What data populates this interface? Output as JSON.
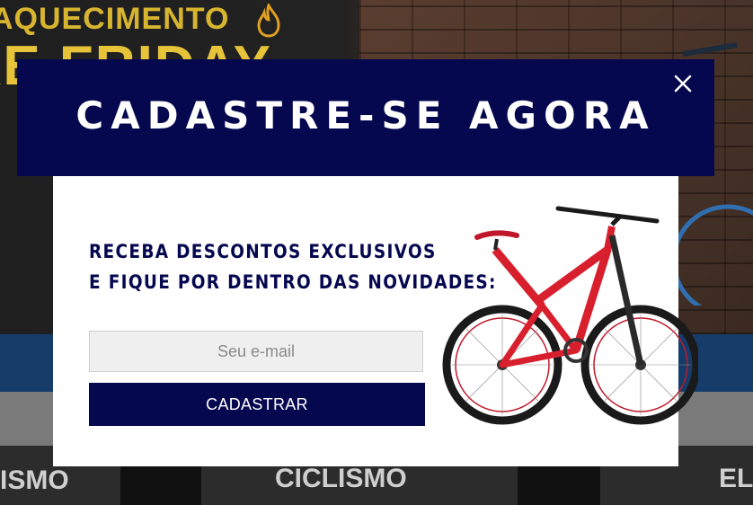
{
  "background": {
    "headline_top": "AQUECIMENTO",
    "headline_big": "XE FRIDAY",
    "tiles": [
      "ISMO",
      "CICLISMO",
      "EL"
    ]
  },
  "modal": {
    "title": "CADASTRE-SE AGORA",
    "promo_line_1": "RECEBA DESCONTOS EXCLUSIVOS",
    "promo_line_2": "E FIQUE POR DENTRO DAS NOVIDADES:",
    "email": {
      "value": "",
      "placeholder": "Seu e-mail"
    },
    "submit_label": "CADASTRAR",
    "close_icon": "close-icon",
    "product_image": "red-mountain-bike"
  },
  "colors": {
    "brand_navy": "#05074f",
    "input_bg": "#efefef",
    "headline_yellow": "#e7c33a"
  }
}
